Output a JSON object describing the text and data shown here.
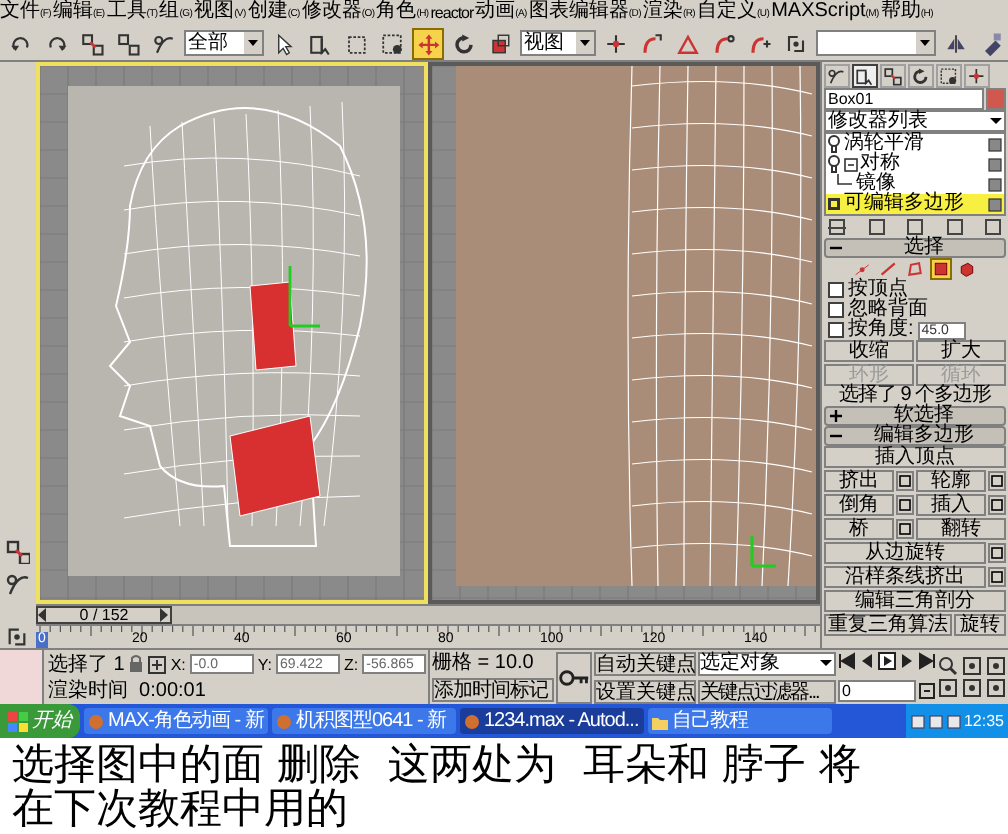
{
  "menu": [
    {
      "label": "文件",
      "accelerator": "(F)"
    },
    {
      "label": "编辑",
      "accelerator": "(E)"
    },
    {
      "label": "工具",
      "accelerator": "(T)"
    },
    {
      "label": "组",
      "accelerator": "(G)"
    },
    {
      "label": "视图",
      "accelerator": "(V)"
    },
    {
      "label": "创建",
      "accelerator": "(C)"
    },
    {
      "label": "修改器",
      "accelerator": "(O)"
    },
    {
      "label": "角色",
      "accelerator": "(H)"
    },
    {
      "label": "reactor"
    },
    {
      "label": "动画",
      "accelerator": "(A)"
    },
    {
      "label": "图表编辑器",
      "accelerator": "(D)"
    },
    {
      "label": "渲染",
      "accelerator": "(R)"
    },
    {
      "label": "自定义",
      "accelerator": "(U)"
    },
    {
      "label": "MAXScript",
      "accelerator": "(M)"
    },
    {
      "label": "帮助",
      "accelerator": "(H)"
    }
  ],
  "toolbar": [
    {
      "kind": "tool",
      "selected": false
    },
    {
      "kind": "tool",
      "selected": false
    },
    {
      "kind": "tool",
      "selected": false
    },
    {
      "kind": "tool",
      "selected": false
    },
    {
      "kind": "tool",
      "selected": false
    },
    {
      "kind": "dropdown",
      "value": "全部"
    },
    {
      "kind": "tool",
      "selected": false
    },
    {
      "kind": "tool",
      "selected": false
    },
    {
      "kind": "tool",
      "selected": false
    },
    {
      "kind": "tool",
      "selected": false
    },
    {
      "kind": "tool",
      "selected": true
    },
    {
      "kind": "tool",
      "selected": false
    },
    {
      "kind": "tool",
      "selected": false
    },
    {
      "kind": "dropdown",
      "value": "视图"
    },
    {
      "kind": "tool",
      "selected": false
    },
    {
      "kind": "tool",
      "selected": false
    },
    {
      "kind": "tool",
      "selected": false
    },
    {
      "kind": "tool",
      "selected": false
    },
    {
      "kind": "tool",
      "selected": false
    },
    {
      "kind": "tool",
      "selected": false
    },
    {
      "kind": "dropdown"
    },
    {
      "kind": "tool",
      "selected": false
    },
    {
      "kind": "tool",
      "selected": false
    }
  ],
  "viewports": [
    {
      "kind": "profile",
      "selected": true
    },
    {
      "kind": "frontal",
      "selected": false
    }
  ],
  "time_slider": {
    "label": "0 / 152",
    "level": 0
  },
  "ruler": {
    "labels": [
      "0",
      "20",
      "40",
      "60",
      "80",
      "100",
      "120",
      "140"
    ]
  },
  "command_panel": {
    "tabs": [
      {
        "selected": false
      },
      {
        "selected": true
      },
      {
        "selected": false
      },
      {
        "selected": false
      },
      {
        "selected": false
      },
      {
        "selected": false
      }
    ],
    "object_name": "Box01",
    "modifier_list": "修改器列表",
    "stack": [
      {
        "kind": "modifier",
        "label": "涡轮平滑",
        "selected": false
      },
      {
        "kind": "modifier",
        "label": "对称",
        "selected": false,
        "expanded": true,
        "children": [
          {
            "kind": "sub",
            "label": "镜像",
            "selected": false
          }
        ]
      },
      {
        "kind": "object",
        "label": "可编辑多边形",
        "selected": true
      }
    ],
    "selection_rollout": {
      "title": "选择",
      "expanded": true,
      "subobject_levels": [
        {
          "selected": false
        },
        {
          "selected": false
        },
        {
          "selected": false
        },
        {
          "selected": true
        },
        {
          "selected": false
        }
      ],
      "checkboxes": [
        {
          "label": "按顶点",
          "checked": false
        },
        {
          "label": "忽略背面",
          "checked": false
        },
        {
          "label": "按角度:",
          "checked": false,
          "value": "45.0"
        }
      ],
      "buttons": [
        {
          "label": "收缩",
          "disabled": false
        },
        {
          "label": "扩大",
          "disabled": false
        },
        {
          "label": "环形",
          "disabled": true
        },
        {
          "label": "循环",
          "disabled": true
        }
      ],
      "info": "选择了 9 个多边形"
    },
    "soft_selection_rollout": {
      "title": "软选择",
      "expanded": false
    },
    "edit_polygons_rollout": {
      "title": "编辑多边形",
      "expanded": true,
      "buttons": [
        {
          "label": "插入顶点",
          "kind": "wide"
        },
        {
          "label": "挤出",
          "kind": "settings"
        },
        {
          "label": "轮廓",
          "kind": "settings"
        },
        {
          "label": "倒角",
          "kind": "settings"
        },
        {
          "label": "插入",
          "kind": "settings"
        },
        {
          "label": "桥",
          "kind": "settings"
        },
        {
          "label": "翻转",
          "kind": "half"
        },
        {
          "label": "从边旋转",
          "kind": "wide_settings"
        },
        {
          "label": "沿样条线挤出",
          "kind": "wide_settings"
        },
        {
          "label": "编辑三角剖分",
          "kind": "wide"
        },
        {
          "label": "重复三角算法",
          "kind": "long"
        },
        {
          "label": "旋转",
          "kind": "short"
        }
      ]
    }
  },
  "status_bar": {
    "selection": "选择了 1",
    "coordinates": [
      {
        "label": "X:",
        "value": "-0.0"
      },
      {
        "label": "Y:",
        "value": "69.422"
      },
      {
        "label": "Z:",
        "value": "-56.865"
      }
    ],
    "render_time": "渲染时间  0:00:01",
    "grid": "栅格 = 10.0",
    "add_time_tag": "添加时间标记",
    "auto_key": "自动关键点",
    "set_key": "设置关键点",
    "key_mode": "选定对象",
    "key_filters": "关键点过滤器...",
    "frame": "0"
  },
  "taskbar": {
    "start": "开始",
    "tasks": [
      {
        "label": "MAX-角色动画 - 新",
        "selected": false
      },
      {
        "label": "机积图型0641 - 新",
        "selected": false
      },
      {
        "label": "1234.max - Autod...",
        "selected": true
      },
      {
        "label": "自己教程",
        "selected": false
      }
    ],
    "clock": "12:35"
  },
  "caption": [
    "选择图中的面 删除  这两处为  耳朵和 脖子 将",
    "在下次教程中用的"
  ]
}
